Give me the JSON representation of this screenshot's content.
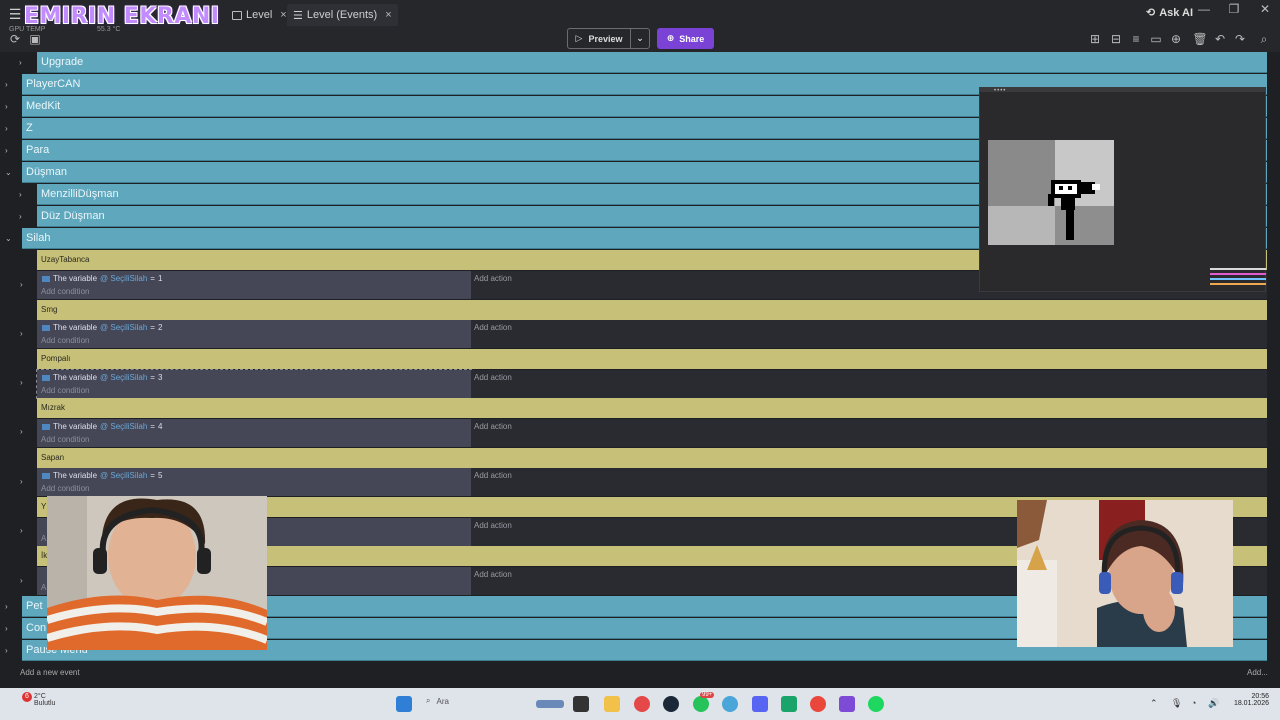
{
  "stream_title": "EMIRIN EKRANI",
  "tabs": [
    {
      "label": "Level",
      "close": "×"
    },
    {
      "label": "Level (Events)",
      "close": "×"
    }
  ],
  "ask_ai": "Ask AI",
  "window_controls": {
    "minimize": "—",
    "maximize": "❐",
    "close": "✕"
  },
  "toolbar": {
    "gpu_label": "GPU TEMP",
    "gpu_value": "55.3 °C",
    "preview_label": "Preview",
    "share_label": "Share",
    "dropdown": "⌄"
  },
  "events": {
    "groups_top": [
      {
        "label": "Upgrade",
        "sub": true
      },
      {
        "label": "PlayerCAN",
        "sub": false
      },
      {
        "label": "MedKit",
        "sub": false
      },
      {
        "label": "Z",
        "sub": false
      },
      {
        "label": "Para",
        "sub": false
      },
      {
        "label": "Düşman",
        "sub": false
      },
      {
        "label": "MenzilliDüşman",
        "sub": true
      },
      {
        "label": "Düz Düşman",
        "sub": true
      },
      {
        "label": "Silah",
        "sub": false
      }
    ],
    "weapons": [
      {
        "name": "UzayTabanca",
        "value": "1"
      },
      {
        "name": "Smg",
        "value": "2"
      },
      {
        "name": "Pompalı",
        "value": "3"
      },
      {
        "name": "Mızrak",
        "value": "4"
      },
      {
        "name": "Sapan",
        "value": "5"
      },
      {
        "name": "Y",
        "value": ""
      },
      {
        "name": "İk",
        "value": ""
      }
    ],
    "condition_text": "The variable",
    "variable_name": "SeçiliSilah",
    "operator": "=",
    "add_condition": "Add condition",
    "add_action": "Add action",
    "condition_partial": "A",
    "groups_bottom": [
      "Pet",
      "Con",
      "Pause Menu"
    ],
    "add_new_event": "Add a new event",
    "add_right": "Add..."
  },
  "overlay": {
    "dots": "••••"
  },
  "taskbar": {
    "weather_temp": "2°C",
    "weather_desc": "Bulutlu",
    "notif_count": "6",
    "search_placeholder": "Ara",
    "time": "20:56",
    "date": "18.01.2026",
    "badge": "99+"
  },
  "colors": {
    "group_row": "#5fa7bd",
    "weapon_row": "#c7c079",
    "condition_bg": "#464756",
    "share_accent": "#7b42d6"
  }
}
